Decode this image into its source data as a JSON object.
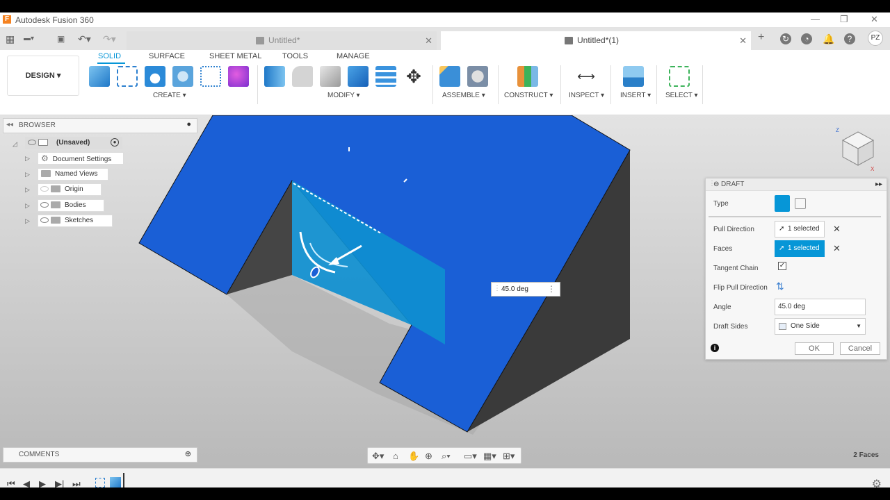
{
  "window": {
    "title": "Autodesk Fusion 360",
    "logo": "F"
  },
  "tabs": [
    {
      "label": "Untitled*",
      "active": false
    },
    {
      "label": "Untitled*(1)",
      "active": true
    }
  ],
  "user": {
    "initials": "PZ"
  },
  "toolbar": {
    "workspace": "DESIGN",
    "workspace_tabs": [
      "SOLID",
      "SURFACE",
      "SHEET METAL",
      "TOOLS",
      "MANAGE"
    ],
    "groups": [
      "CREATE",
      "MODIFY",
      "ASSEMBLE",
      "CONSTRUCT",
      "INSPECT",
      "INSERT",
      "SELECT"
    ]
  },
  "browser": {
    "title": "BROWSER",
    "root": "(Unsaved)",
    "items": [
      "Document Settings",
      "Named Views",
      "Origin",
      "Bodies",
      "Sketches"
    ]
  },
  "comments": {
    "title": "COMMENTS"
  },
  "viewport": {
    "angle_value": "45.0 deg",
    "status": "2 Faces",
    "model_color": "#1a5fd6",
    "selected_face_color": "#0e8fd0"
  },
  "draft": {
    "title": "DRAFT",
    "type_label": "Type",
    "pull_direction_label": "Pull Direction",
    "pull_direction_value": "1 selected",
    "faces_label": "Faces",
    "faces_value": "1 selected",
    "tangent_chain_label": "Tangent Chain",
    "tangent_chain_checked": true,
    "flip_label": "Flip Pull Direction",
    "angle_label": "Angle",
    "angle_value": "45.0 deg",
    "draft_sides_label": "Draft Sides",
    "draft_sides_value": "One Side",
    "ok_label": "OK",
    "cancel_label": "Cancel"
  },
  "accent_color": "#0696d7"
}
